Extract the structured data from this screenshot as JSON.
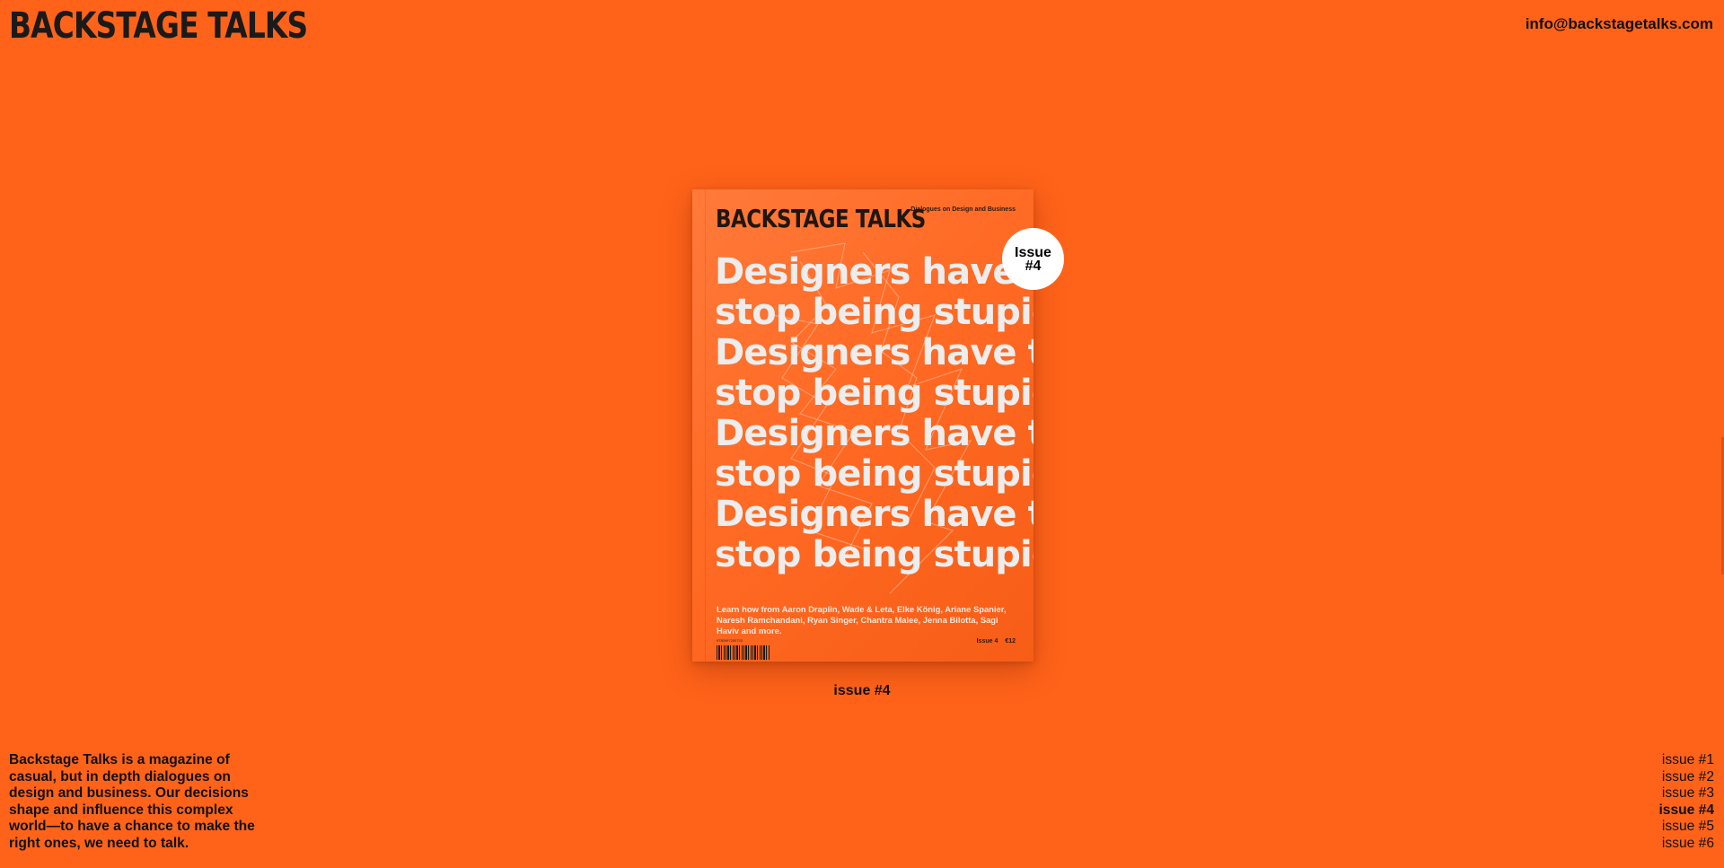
{
  "site": {
    "logo": "BACKSTAGE TALKS",
    "email": "info@backstagetalks.com"
  },
  "cover": {
    "brand": "BACKSTAGE TALKS",
    "tagline": "Dialogues on Design and Business",
    "headline_lines": [
      "Designers have to",
      "stop being stupid.",
      "Designers have to",
      "stop being stupid.",
      "Designers have to",
      "stop being stupid.",
      "Designers have to",
      "stop being stupid."
    ],
    "contributors": "Learn how from Aaron Draplin, Wade & Leta, Elke König, Ariane Spanier, Naresh Ramchandani, Ryan Singer, Chantra Malee, Jenna Bilotta, Sagi Haviv and more.",
    "isbn": "9780997200733",
    "issue_label": "Issue 4",
    "price": "€12"
  },
  "badge": {
    "line1": "Issue",
    "line2": "#4"
  },
  "current_issue_caption": "issue #4",
  "about": "Backstage Talks is a magazine of casual, but in depth dialogues on design and business. Our decisions shape and influence this complex world—to have a chance to make the right ones, we need to talk.",
  "issues": [
    {
      "label": "issue #1",
      "active": false
    },
    {
      "label": "issue #2",
      "active": false
    },
    {
      "label": "issue #3",
      "active": false
    },
    {
      "label": "issue #4",
      "active": true
    },
    {
      "label": "issue #5",
      "active": false
    },
    {
      "label": "issue #6",
      "active": false
    }
  ],
  "colors": {
    "background": "#ff6319",
    "text": "#111111",
    "badge": "#ffffff"
  }
}
